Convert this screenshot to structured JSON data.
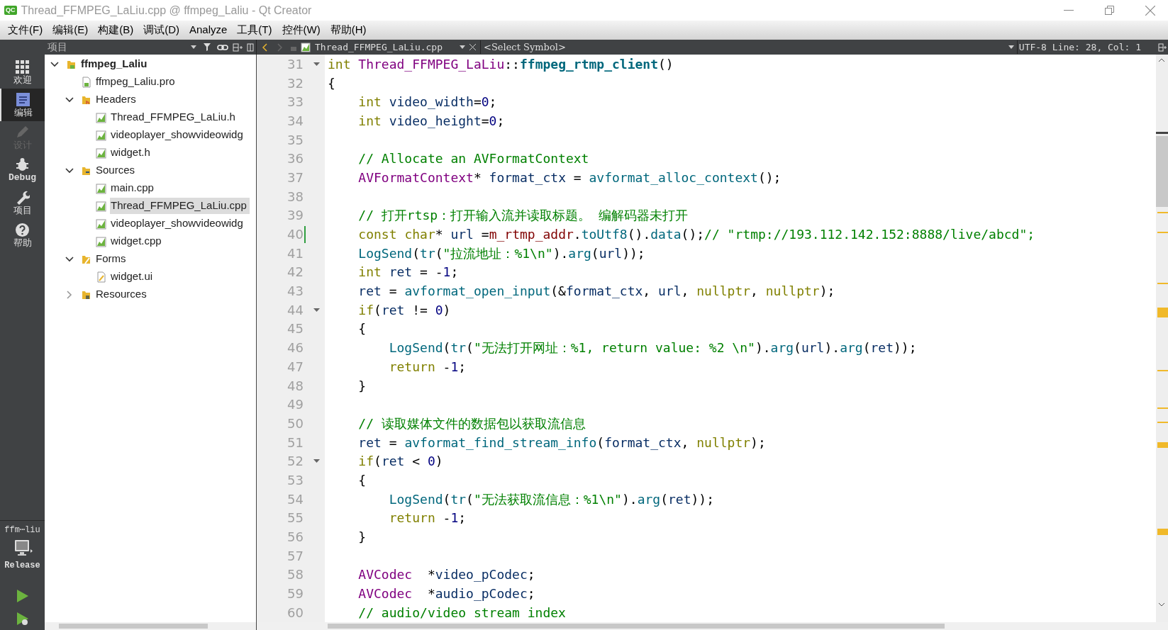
{
  "window": {
    "title": "Thread_FFMPEG_LaLiu.cpp @ ffmpeg_Laliu - Qt Creator",
    "app_badge": "QC"
  },
  "menu": [
    "文件(F)",
    "编辑(E)",
    "构建(B)",
    "调试(D)",
    "Analyze",
    "工具(T)",
    "控件(W)",
    "帮助(H)"
  ],
  "modes": [
    {
      "kind": "grid",
      "label": "欢迎",
      "selected": false,
      "disabled": false
    },
    {
      "kind": "document",
      "label": "编辑",
      "selected": true,
      "disabled": false
    },
    {
      "kind": "pencil",
      "label": "设计",
      "selected": false,
      "disabled": true
    },
    {
      "kind": "bug",
      "label": "Debug",
      "selected": false,
      "disabled": false
    },
    {
      "kind": "wrench",
      "label": "项目",
      "selected": false,
      "disabled": false
    },
    {
      "kind": "help",
      "label": "帮助",
      "selected": false,
      "disabled": false
    }
  ],
  "build_target": {
    "project": "ffm⋯liu",
    "configuration": "Release"
  },
  "project_pane": {
    "title": "项目"
  },
  "tree": [
    {
      "kind": "project",
      "label": "ffmpeg_Laliu",
      "expanded": true,
      "selected": false,
      "children": [
        {
          "kind": "pro-file",
          "label": "ffmpeg_Laliu.pro",
          "selected": false
        },
        {
          "kind": "headers-folder",
          "label": "Headers",
          "expanded": true,
          "selected": false,
          "children": [
            {
              "kind": "source-file",
              "label": "Thread_FFMPEG_LaLiu.h",
              "selected": false
            },
            {
              "kind": "source-file",
              "label": "videoplayer_showvideowidg",
              "selected": false
            },
            {
              "kind": "source-file",
              "label": "widget.h",
              "selected": false
            }
          ]
        },
        {
          "kind": "sources-folder",
          "label": "Sources",
          "expanded": true,
          "selected": false,
          "children": [
            {
              "kind": "source-file",
              "label": "main.cpp",
              "selected": false
            },
            {
              "kind": "source-file",
              "label": "Thread_FFMPEG_LaLiu.cpp",
              "selected": true
            },
            {
              "kind": "source-file",
              "label": "videoplayer_showvideowidg",
              "selected": false
            },
            {
              "kind": "source-file",
              "label": "widget.cpp",
              "selected": false
            }
          ]
        },
        {
          "kind": "forms-folder",
          "label": "Forms",
          "expanded": true,
          "selected": false,
          "children": [
            {
              "kind": "form-file",
              "label": "widget.ui",
              "selected": false
            }
          ]
        },
        {
          "kind": "resources-folder",
          "label": "Resources",
          "expanded": false,
          "selected": false
        }
      ]
    }
  ],
  "editor_toolbar": {
    "file": "Thread_FFMPEG_LaLiu.cpp",
    "symbol": "<Select Symbol>",
    "status": "UTF-8 Line: 28, Col: 1"
  },
  "code_lines": [
    {
      "number": "31",
      "foldable": true,
      "modified": false,
      "tokens": [
        {
          "kind": "kw",
          "text": "int"
        },
        {
          "kind": "type",
          "text": " Thread_FFMPEG_LaLiu"
        },
        {
          "kind": "plain",
          "text": "::"
        },
        {
          "kind": "fdef",
          "text": "ffmpeg_rtmp_client"
        },
        {
          "kind": "plain",
          "text": "()"
        }
      ]
    },
    {
      "number": "32",
      "foldable": false,
      "modified": false,
      "tokens": [
        {
          "kind": "plain",
          "text": "{"
        }
      ]
    },
    {
      "number": "33",
      "foldable": false,
      "modified": false,
      "tokens": [
        {
          "kind": "kw",
          "text": "    int"
        },
        {
          "kind": "var",
          "text": " video_width"
        },
        {
          "kind": "plain",
          "text": "="
        },
        {
          "kind": "num",
          "text": "0"
        },
        {
          "kind": "plain",
          "text": ";"
        }
      ]
    },
    {
      "number": "34",
      "foldable": false,
      "modified": false,
      "tokens": [
        {
          "kind": "kw",
          "text": "    int"
        },
        {
          "kind": "var",
          "text": " video_height"
        },
        {
          "kind": "plain",
          "text": "="
        },
        {
          "kind": "num",
          "text": "0"
        },
        {
          "kind": "plain",
          "text": ";"
        }
      ]
    },
    {
      "number": "35",
      "foldable": false,
      "modified": false
    },
    {
      "number": "36",
      "foldable": false,
      "modified": false,
      "tokens": [
        {
          "kind": "comment",
          "text": "    // Allocate an AVFormatContext"
        }
      ]
    },
    {
      "number": "37",
      "foldable": false,
      "modified": false,
      "tokens": [
        {
          "kind": "type",
          "text": "    AVFormatContext"
        },
        {
          "kind": "plain",
          "text": "* "
        },
        {
          "kind": "var",
          "text": "format_ctx"
        },
        {
          "kind": "plain",
          "text": " = "
        },
        {
          "kind": "func",
          "text": "avformat_alloc_context"
        },
        {
          "kind": "plain",
          "text": "();"
        }
      ]
    },
    {
      "number": "38",
      "foldable": false,
      "modified": false
    },
    {
      "number": "39",
      "foldable": false,
      "modified": false,
      "tokens": [
        {
          "kind": "comment",
          "text": "    // 打开rtsp：打开输入流并读取标题。 编解码器未打开"
        }
      ]
    },
    {
      "number": "40",
      "foldable": false,
      "modified": true,
      "tokens": [
        {
          "kind": "kw",
          "text": "    const"
        },
        {
          "kind": "kw",
          "text": " char"
        },
        {
          "kind": "plain",
          "text": "* "
        },
        {
          "kind": "var",
          "text": "url"
        },
        {
          "kind": "plain",
          "text": " ="
        },
        {
          "kind": "member",
          "text": "m_rtmp_addr"
        },
        {
          "kind": "plain",
          "text": "."
        },
        {
          "kind": "func",
          "text": "toUtf8"
        },
        {
          "kind": "plain",
          "text": "()."
        },
        {
          "kind": "func",
          "text": "data"
        },
        {
          "kind": "plain",
          "text": "();"
        },
        {
          "kind": "comment",
          "text": "// \"rtmp://193.112.142.152:8888/live/abcd\";"
        }
      ]
    },
    {
      "number": "41",
      "foldable": false,
      "modified": false,
      "tokens": [
        {
          "kind": "func",
          "text": "    LogSend"
        },
        {
          "kind": "plain",
          "text": "("
        },
        {
          "kind": "func",
          "text": "tr"
        },
        {
          "kind": "plain",
          "text": "("
        },
        {
          "kind": "str",
          "text": "\"拉流地址：%1\\n\""
        },
        {
          "kind": "plain",
          "text": ")."
        },
        {
          "kind": "func",
          "text": "arg"
        },
        {
          "kind": "plain",
          "text": "("
        },
        {
          "kind": "var",
          "text": "url"
        },
        {
          "kind": "plain",
          "text": "));"
        }
      ]
    },
    {
      "number": "42",
      "foldable": false,
      "modified": false,
      "tokens": [
        {
          "kind": "kw",
          "text": "    int"
        },
        {
          "kind": "var",
          "text": " ret"
        },
        {
          "kind": "plain",
          "text": " = -"
        },
        {
          "kind": "num",
          "text": "1"
        },
        {
          "kind": "plain",
          "text": ";"
        }
      ]
    },
    {
      "number": "43",
      "foldable": false,
      "modified": false,
      "tokens": [
        {
          "kind": "var",
          "text": "    ret"
        },
        {
          "kind": "plain",
          "text": " = "
        },
        {
          "kind": "func",
          "text": "avformat_open_input"
        },
        {
          "kind": "plain",
          "text": "(&"
        },
        {
          "kind": "var",
          "text": "format_ctx"
        },
        {
          "kind": "plain",
          "text": ", "
        },
        {
          "kind": "var",
          "text": "url"
        },
        {
          "kind": "plain",
          "text": ", "
        },
        {
          "kind": "kw",
          "text": "nullptr"
        },
        {
          "kind": "plain",
          "text": ", "
        },
        {
          "kind": "kw",
          "text": "nullptr"
        },
        {
          "kind": "plain",
          "text": ");"
        }
      ]
    },
    {
      "number": "44",
      "foldable": true,
      "modified": false,
      "tokens": [
        {
          "kind": "kw",
          "text": "    if"
        },
        {
          "kind": "plain",
          "text": "("
        },
        {
          "kind": "var",
          "text": "ret"
        },
        {
          "kind": "plain",
          "text": " != "
        },
        {
          "kind": "num",
          "text": "0"
        },
        {
          "kind": "plain",
          "text": ")"
        }
      ]
    },
    {
      "number": "45",
      "foldable": false,
      "modified": false,
      "tokens": [
        {
          "kind": "plain",
          "text": "    {"
        }
      ]
    },
    {
      "number": "46",
      "foldable": false,
      "modified": false,
      "tokens": [
        {
          "kind": "func",
          "text": "        LogSend"
        },
        {
          "kind": "plain",
          "text": "("
        },
        {
          "kind": "func",
          "text": "tr"
        },
        {
          "kind": "plain",
          "text": "("
        },
        {
          "kind": "str",
          "text": "\"无法打开网址：%1, return value: %2 \\n\""
        },
        {
          "kind": "plain",
          "text": ")."
        },
        {
          "kind": "func",
          "text": "arg"
        },
        {
          "kind": "plain",
          "text": "("
        },
        {
          "kind": "var",
          "text": "url"
        },
        {
          "kind": "plain",
          "text": ")."
        },
        {
          "kind": "func",
          "text": "arg"
        },
        {
          "kind": "plain",
          "text": "("
        },
        {
          "kind": "var",
          "text": "ret"
        },
        {
          "kind": "plain",
          "text": "));"
        }
      ]
    },
    {
      "number": "47",
      "foldable": false,
      "modified": false,
      "tokens": [
        {
          "kind": "kw",
          "text": "        return"
        },
        {
          "kind": "plain",
          "text": " -"
        },
        {
          "kind": "num",
          "text": "1"
        },
        {
          "kind": "plain",
          "text": ";"
        }
      ]
    },
    {
      "number": "48",
      "foldable": false,
      "modified": false,
      "tokens": [
        {
          "kind": "plain",
          "text": "    }"
        }
      ]
    },
    {
      "number": "49",
      "foldable": false,
      "modified": false
    },
    {
      "number": "50",
      "foldable": false,
      "modified": false,
      "tokens": [
        {
          "kind": "comment",
          "text": "    // 读取媒体文件的数据包以获取流信息"
        }
      ]
    },
    {
      "number": "51",
      "foldable": false,
      "modified": false,
      "tokens": [
        {
          "kind": "var",
          "text": "    ret"
        },
        {
          "kind": "plain",
          "text": " = "
        },
        {
          "kind": "func",
          "text": "avformat_find_stream_info"
        },
        {
          "kind": "plain",
          "text": "("
        },
        {
          "kind": "var",
          "text": "format_ctx"
        },
        {
          "kind": "plain",
          "text": ", "
        },
        {
          "kind": "kw",
          "text": "nullptr"
        },
        {
          "kind": "plain",
          "text": ");"
        }
      ]
    },
    {
      "number": "52",
      "foldable": true,
      "modified": false,
      "tokens": [
        {
          "kind": "kw",
          "text": "    if"
        },
        {
          "kind": "plain",
          "text": "("
        },
        {
          "kind": "var",
          "text": "ret"
        },
        {
          "kind": "plain",
          "text": " < "
        },
        {
          "kind": "num",
          "text": "0"
        },
        {
          "kind": "plain",
          "text": ")"
        }
      ]
    },
    {
      "number": "53",
      "foldable": false,
      "modified": false,
      "tokens": [
        {
          "kind": "plain",
          "text": "    {"
        }
      ]
    },
    {
      "number": "54",
      "foldable": false,
      "modified": false,
      "tokens": [
        {
          "kind": "func",
          "text": "        LogSend"
        },
        {
          "kind": "plain",
          "text": "("
        },
        {
          "kind": "func",
          "text": "tr"
        },
        {
          "kind": "plain",
          "text": "("
        },
        {
          "kind": "str",
          "text": "\"无法获取流信息：%1\\n\""
        },
        {
          "kind": "plain",
          "text": ")."
        },
        {
          "kind": "func",
          "text": "arg"
        },
        {
          "kind": "plain",
          "text": "("
        },
        {
          "kind": "var",
          "text": "ret"
        },
        {
          "kind": "plain",
          "text": "));"
        }
      ]
    },
    {
      "number": "55",
      "foldable": false,
      "modified": false,
      "tokens": [
        {
          "kind": "kw",
          "text": "        return"
        },
        {
          "kind": "plain",
          "text": " -"
        },
        {
          "kind": "num",
          "text": "1"
        },
        {
          "kind": "plain",
          "text": ";"
        }
      ]
    },
    {
      "number": "56",
      "foldable": false,
      "modified": false,
      "tokens": [
        {
          "kind": "plain",
          "text": "    }"
        }
      ]
    },
    {
      "number": "57",
      "foldable": false,
      "modified": false
    },
    {
      "number": "58",
      "foldable": false,
      "modified": false,
      "tokens": [
        {
          "kind": "type",
          "text": "    AVCodec"
        },
        {
          "kind": "plain",
          "text": "  *"
        },
        {
          "kind": "var",
          "text": "video_pCodec"
        },
        {
          "kind": "plain",
          "text": ";"
        }
      ]
    },
    {
      "number": "59",
      "foldable": false,
      "modified": false,
      "tokens": [
        {
          "kind": "type",
          "text": "    AVCodec"
        },
        {
          "kind": "plain",
          "text": "  *"
        },
        {
          "kind": "var",
          "text": "audio_pCodec"
        },
        {
          "kind": "plain",
          "text": ";"
        }
      ]
    },
    {
      "number": "60",
      "foldable": false,
      "modified": false,
      "tokens": [
        {
          "kind": "comment",
          "text": "    // audio/video stream index"
        }
      ]
    }
  ]
}
